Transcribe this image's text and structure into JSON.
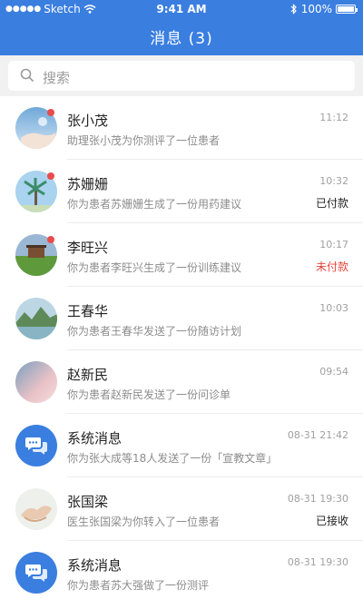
{
  "status_bar": {
    "carrier": "Sketch",
    "time": "9:41 AM",
    "battery": "100%"
  },
  "header": {
    "title": "消息 (3)"
  },
  "search": {
    "placeholder": "搜索"
  },
  "messages": [
    {
      "name": "张小茂",
      "subtitle": "助理张小茂为你测评了一位患者",
      "time": "11:12",
      "tag": "",
      "unread": true
    },
    {
      "name": "苏姗姗",
      "subtitle": "你为患者苏姗姗生成了一份用药建议",
      "time": "10:32",
      "tag": "已付款",
      "unread": true
    },
    {
      "name": "李旺兴",
      "subtitle": "你为患者李旺兴生成了一份训练建议",
      "time": "10:17",
      "tag": "未付款",
      "unread": true
    },
    {
      "name": "王春华",
      "subtitle": "你为患者王春华发送了一份随访计划",
      "time": "10:03",
      "tag": "",
      "unread": false
    },
    {
      "name": "赵新民",
      "subtitle": "你为患者赵新民发送了一份问诊单",
      "time": "09:54",
      "tag": "",
      "unread": false
    },
    {
      "name": "系统消息",
      "subtitle": "你为张大成等18人发送了一份「宣教文章」",
      "time": "08-31 21:42",
      "tag": "",
      "unread": false
    },
    {
      "name": "张国梁",
      "subtitle": "医生张国梁为你转入了一位患者",
      "time": "08-31 19:30",
      "tag": "已接收",
      "unread": false
    },
    {
      "name": "系统消息",
      "subtitle": "你为患者苏大强做了一份测评",
      "time": "08-31 19:30",
      "tag": "",
      "unread": false
    }
  ],
  "colors": {
    "header_blue": "#3a7ee0",
    "unread_dot": "#e84c4c",
    "unpaid_red": "#e8453c"
  }
}
